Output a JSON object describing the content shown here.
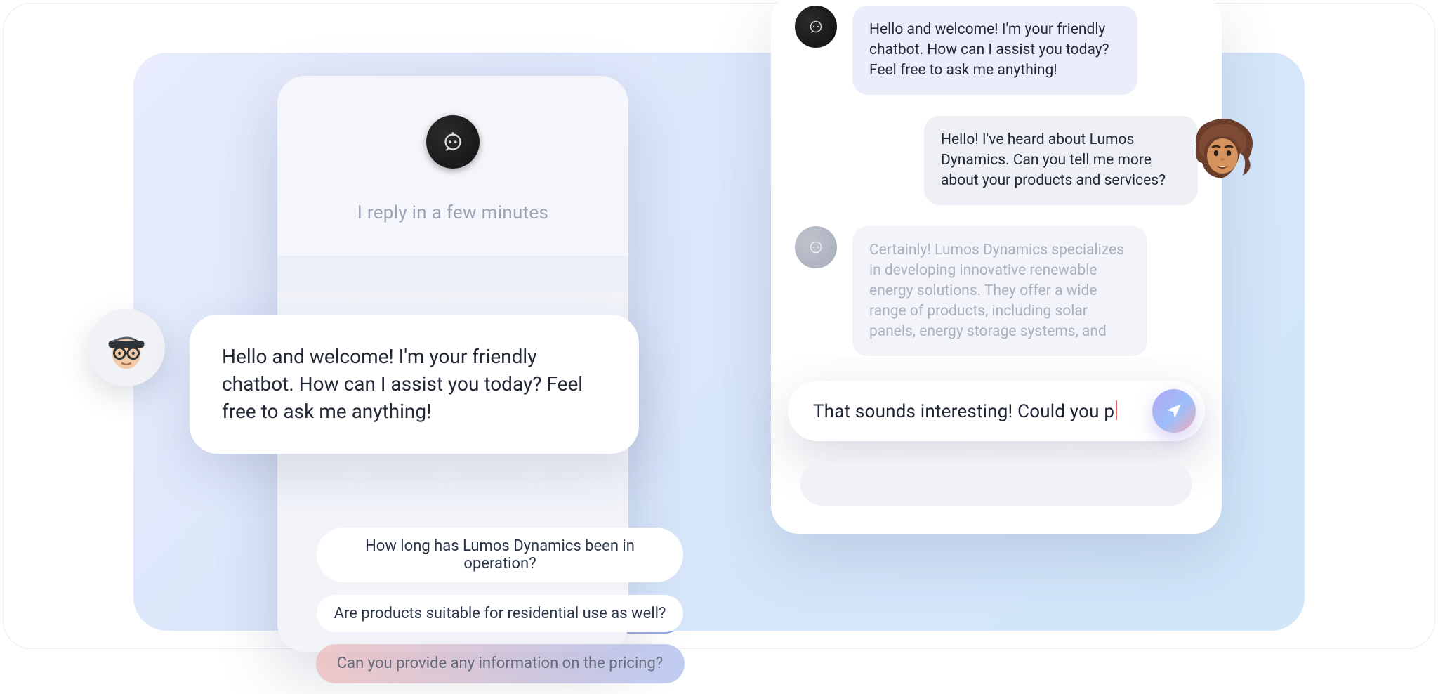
{
  "left": {
    "reply_hint": "I reply in a few minutes",
    "welcome": "Hello and welcome! I'm your friendly chatbot. How can I assist you today? Feel free to ask me anything!",
    "suggestions": [
      "How long has Lumos Dynamics been in operation?",
      "Are products suitable for residential use as well?",
      "Can you provide any information on the pricing?"
    ]
  },
  "right": {
    "messages": {
      "bot1": "Hello and welcome! I'm your friendly chatbot. How can I assist you today? Feel free to ask me anything!",
      "user1": "Hello! I've heard about Lumos Dynamics. Can you tell me more about your products and services?",
      "bot2": "Certainly! Lumos Dynamics specializes in developing innovative renewable energy solutions. They offer a wide range of products, including solar panels, energy storage systems, and"
    },
    "input_value": "That sounds interesting! Could you p"
  },
  "icons": {
    "chatbot": "chatbot-icon",
    "send": "send-icon"
  },
  "colors": {
    "bg_grad_start": "#e8ecfc",
    "bubble_bot": "#eaeefb",
    "bubble_user": "#eef0f6"
  }
}
